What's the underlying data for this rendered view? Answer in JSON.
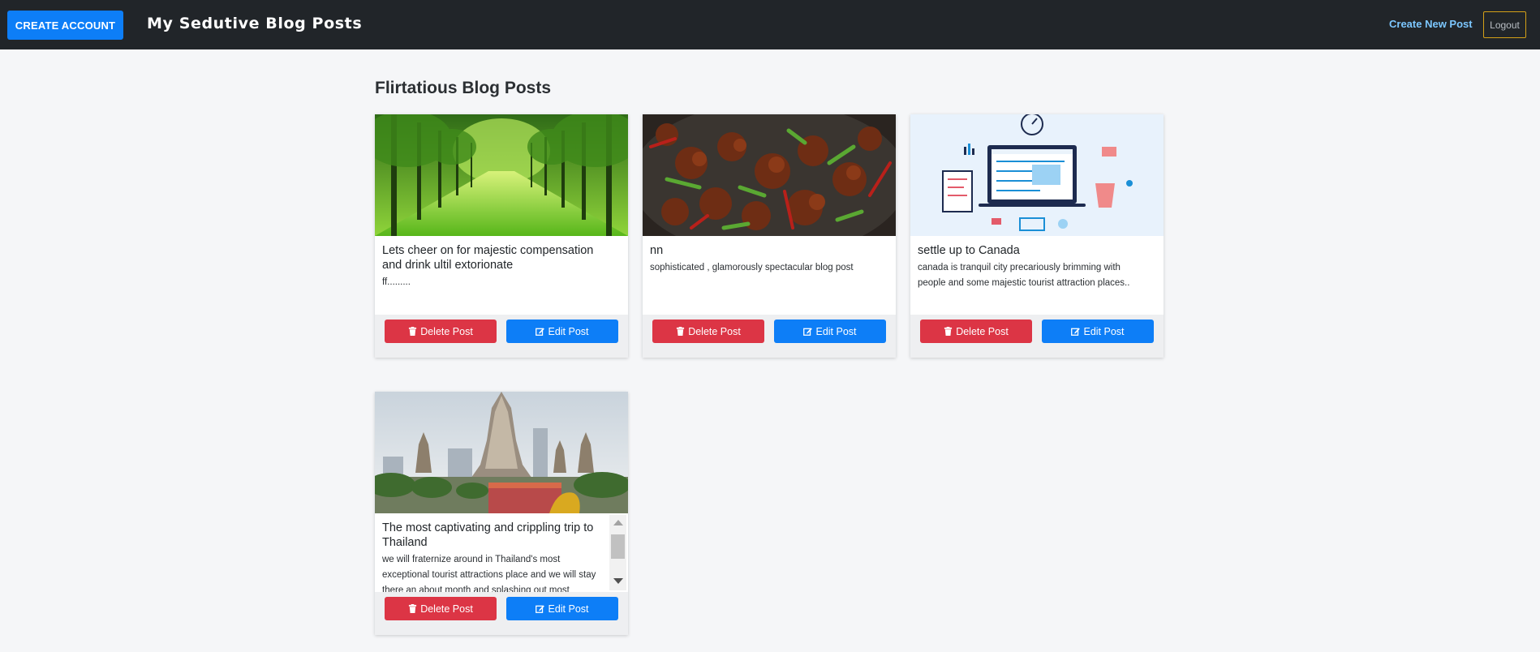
{
  "navbar": {
    "create_account_label": "CREATE ACCOUNT",
    "brand": "My Sedutive Blog Posts",
    "create_post_label": "Create New Post",
    "logout_label": "Logout"
  },
  "page": {
    "title": "Flirtatious Blog Posts"
  },
  "actions": {
    "delete_label": "Delete Post",
    "edit_label": "Edit Post"
  },
  "posts": [
    {
      "title": "Lets cheer on for majestic compensation and drink ultil extorionate",
      "body": "ff.........",
      "image_icon": "tree-lined-path-image"
    },
    {
      "title": "nn",
      "body": "sophisticated , glamorously spectacular blog post",
      "image_icon": "stir-fry-dish-image"
    },
    {
      "title": "settle up to Canada",
      "body": "canada is tranquil city precariously brimming with people and some majestic tourist attraction places..",
      "image_icon": "project-management-illustration"
    },
    {
      "title": "The most captivating and crippling trip to Thailand",
      "body": "we will fraternize around in Thailand's most exceptional tourist attractions place and we will stay there an about month and splashing out most",
      "image_icon": "thailand-temple-image"
    }
  ],
  "colors": {
    "navbar_bg": "#212529",
    "primary": "#0d7ef7",
    "danger": "#dc3545",
    "logout_border": "#d4a017"
  }
}
